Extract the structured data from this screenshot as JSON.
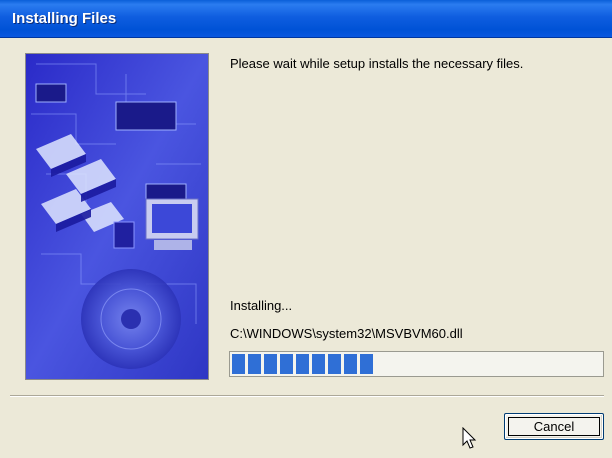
{
  "window": {
    "title": "Installing Files"
  },
  "content": {
    "message": "Please wait while setup installs the necessary files.",
    "status_label": "Installing...",
    "current_file": "C:\\WINDOWS\\system32\\MSVBVM60.dll",
    "progress_fraction": 0.39
  },
  "buttons": {
    "cancel_label": "Cancel"
  },
  "icons": {
    "cursor": "mouse-pointer-icon",
    "banner": "setup-banner-image"
  },
  "colors": {
    "title_bar": "#0052d6",
    "progress_fill": "#2f6fd6",
    "dialog_background": "#ece9d8"
  }
}
